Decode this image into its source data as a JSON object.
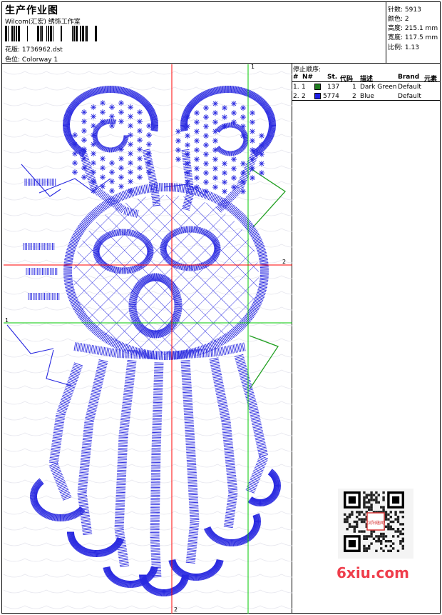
{
  "header": {
    "title": "生产作业图",
    "company": "Wilcom(汇宏) 绣饰工作室"
  },
  "file_info": {
    "design_label": "花版:",
    "design_value": "1736962.dst",
    "colorway_label": "色位:",
    "colorway_value": "Colorway 1"
  },
  "stats": [
    {
      "label": "针数:",
      "value": "5913"
    },
    {
      "label": "颜色:",
      "value": "2"
    },
    {
      "label": "高度:",
      "value": "215.1 mm"
    },
    {
      "label": "宽度:",
      "value": "117.5 mm"
    },
    {
      "label": "比例:",
      "value": "1.13"
    }
  ],
  "stop_sequence": {
    "title": "停止顺序:",
    "columns": [
      "#",
      "N#",
      "St.",
      "代码",
      "描述",
      "Brand",
      "元素"
    ],
    "rows": [
      {
        "index": "1.",
        "n": "1",
        "stitches": "137",
        "code": "1",
        "description": "Dark Green",
        "brand": "Default",
        "color": "#1f7a1f"
      },
      {
        "index": "2.",
        "n": "2",
        "stitches": "5774",
        "code": "2",
        "description": "Blue",
        "brand": "Default",
        "color": "#1e1ee6"
      }
    ]
  },
  "guides": {
    "green_top_label": "1",
    "green_left_label": "1",
    "red_right_label": "2",
    "red_bottom_label": "2"
  },
  "colors": {
    "blue_thread": "#2828e0",
    "green_thread": "#22a022",
    "red_guide": "#ff0000",
    "green_guide": "#00c800"
  },
  "watermark": {
    "text": "6xiu.com",
    "qr_caption": "汉阳蕴闻"
  }
}
